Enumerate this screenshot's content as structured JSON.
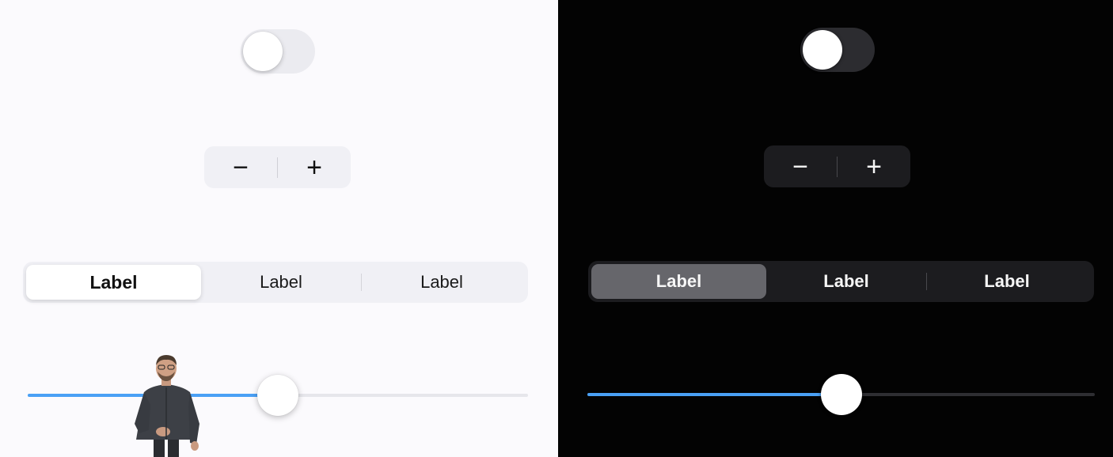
{
  "light": {
    "toggle": {
      "on": false
    },
    "stepper": {
      "minus": "−",
      "plus": "+"
    },
    "segmented": {
      "segments": [
        "Label",
        "Label",
        "Label"
      ],
      "selected_index": 0
    },
    "slider": {
      "value": 0.5
    }
  },
  "dark": {
    "toggle": {
      "on": false
    },
    "stepper": {
      "minus": "−",
      "plus": "+"
    },
    "segmented": {
      "segments": [
        "Label",
        "Label",
        "Label"
      ],
      "selected_index": 0
    },
    "slider": {
      "value": 0.5
    }
  },
  "colors": {
    "accent": "#4aa0f5",
    "light_background": "#fbfafd",
    "dark_background": "#030303"
  }
}
